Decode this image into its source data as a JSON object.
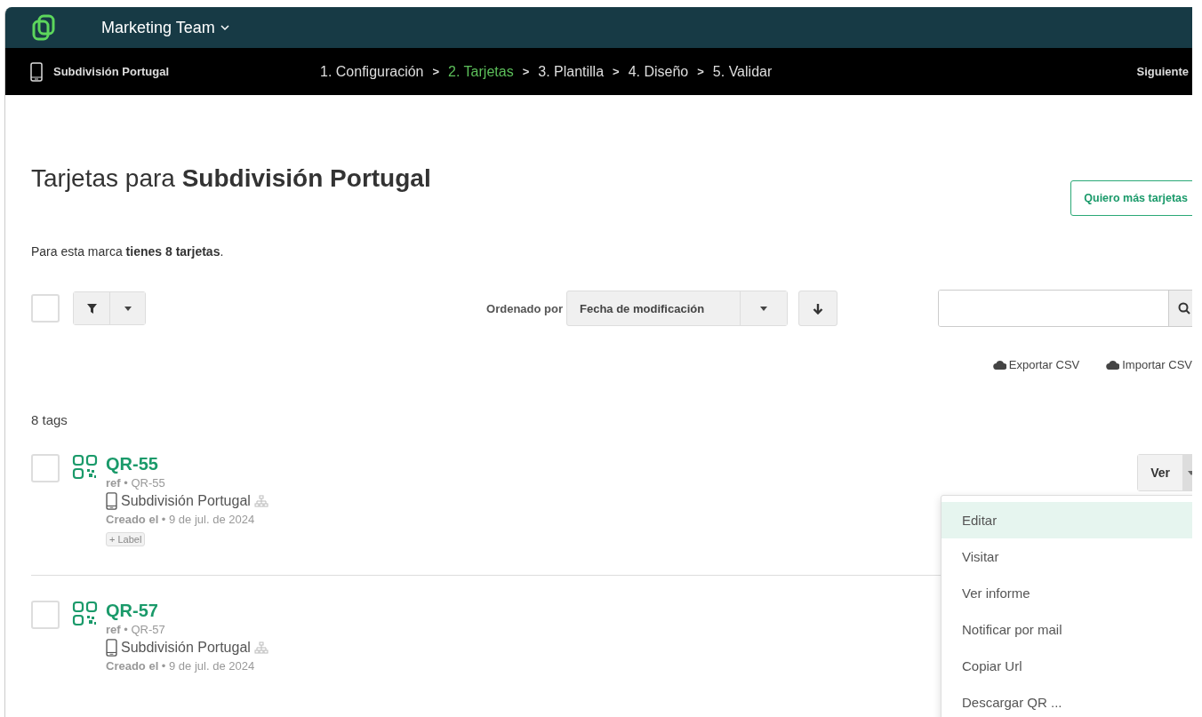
{
  "header": {
    "team": "Marketing Team"
  },
  "wizard": {
    "brand": "Subdivisión Portugal",
    "steps": [
      {
        "label": "1. Configuración",
        "selected": false
      },
      {
        "separator": ">",
        "label": "2. Tarjetas",
        "selected": true
      },
      {
        "separator": ">",
        "label": "3. Plantilla",
        "selected": false
      },
      {
        "separator": ">",
        "label": "4. Diseño",
        "selected": false
      },
      {
        "separator": ">",
        "label": "5. Validar",
        "selected": false
      }
    ],
    "next": "Siguiente"
  },
  "page": {
    "title": "Tarjetas para **Subdivisión Portugal**",
    "more_button": "Quiero más tarjetas",
    "summary": "Para esta marca **tienes 8 tarjetas**."
  },
  "toolbar": {
    "select_all_checked": false,
    "sort_label": "Ordenado por",
    "sort_value": "Fecha de modificación",
    "export": "Exportar CSV",
    "import": "Importar CSV"
  },
  "count": "8 tags",
  "cards": [
    {
      "name": "QR-55",
      "ref": "**ref** • QR-55",
      "brand": "Subdivisión Portugal",
      "created": "**Creado el** • 9 de jul. de 2024",
      "label_button": "+ Label",
      "checked": false,
      "action": "Ver"
    },
    {
      "name": "QR-57",
      "ref": "**ref** • QR-57",
      "brand": "Subdivisión Portugal",
      "created": "**Creado el** • 9 de jul. de 2024",
      "checked": false
    }
  ],
  "menu": [
    {
      "label": "Editar",
      "selected": true
    },
    {
      "label": "Visitar",
      "selected": false
    },
    {
      "label": "Ver informe",
      "selected": false
    },
    {
      "label": "Notificar por mail",
      "selected": false
    },
    {
      "label": "Copiar Url",
      "selected": false
    },
    {
      "label": "Descargar QR ...",
      "selected": false
    }
  ]
}
